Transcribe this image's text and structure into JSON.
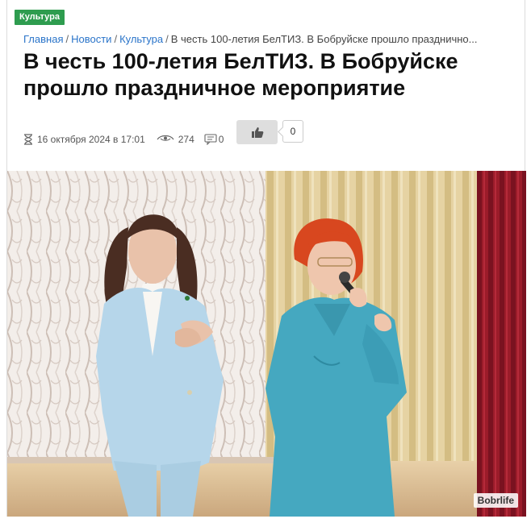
{
  "category": {
    "label": "Культура"
  },
  "breadcrumb": {
    "items": [
      "Главная",
      "Новости",
      "Культура"
    ],
    "separator": "/",
    "current": "В честь 100-летия БелТИЗ. В Бобруйске прошло празднично..."
  },
  "article": {
    "title": "В честь 100-летия БелТИЗ. В Бобруйске прошло праздничное мероприятие",
    "date": "16 октября 2024 в 17:01",
    "views": "274",
    "comments": "0",
    "likes": "0"
  },
  "photo": {
    "watermark": "Bobrlife"
  },
  "icons": {
    "date": "hourglass-icon",
    "views": "eye-icon",
    "comments": "comment-icon",
    "like": "thumbs-up-icon"
  },
  "colors": {
    "category_badge": "#2e9c4f",
    "link": "#2a74c9",
    "like_button": "#dedede"
  }
}
